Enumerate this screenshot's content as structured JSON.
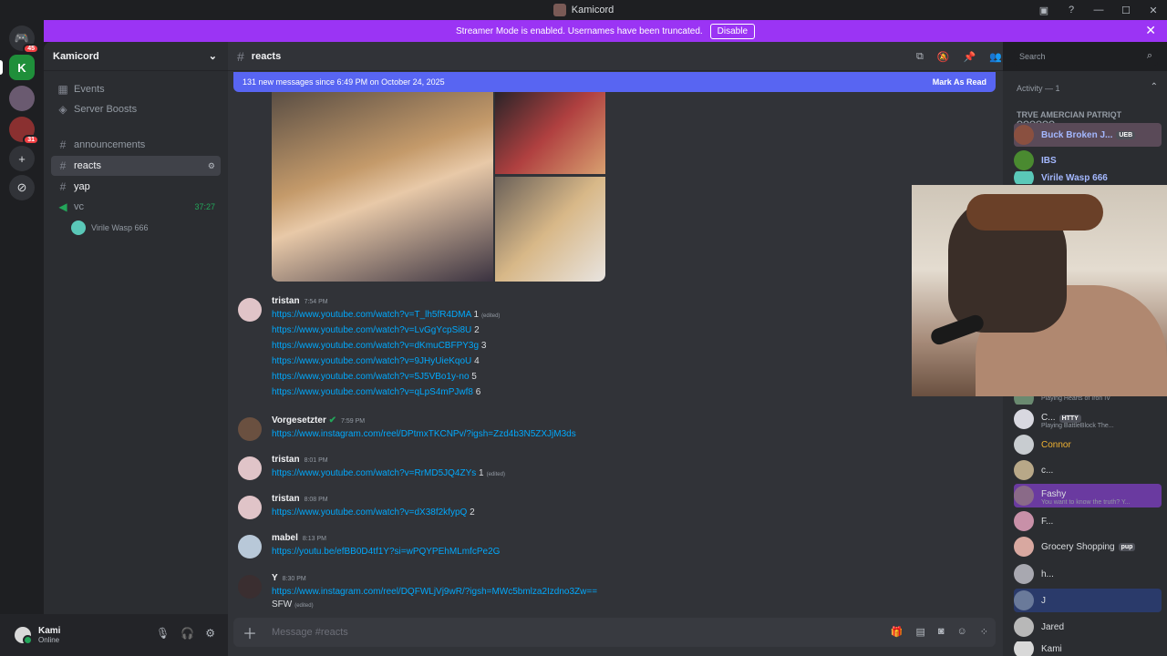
{
  "window": {
    "title": "Kamicord"
  },
  "banner": {
    "text": "Streamer Mode is enabled. Usernames have been truncated.",
    "disable_label": "Disable"
  },
  "servers": [
    {
      "name": "Home",
      "badge": "45"
    },
    {
      "name": "K",
      "badge": ""
    },
    {
      "name": "Kamicord",
      "badge": ""
    },
    {
      "name": "Server",
      "badge": "31"
    }
  ],
  "sidebar": {
    "server_name": "Kamicord",
    "items": [
      {
        "label": "Events"
      },
      {
        "label": "Server Boosts"
      },
      {
        "label": "announcements"
      },
      {
        "label": "reacts"
      },
      {
        "label": "yap"
      },
      {
        "label": "vc",
        "timer": "37:27"
      }
    ],
    "voice_user": "Virile Wasp 666"
  },
  "user": {
    "name": "Kami",
    "status": "Online"
  },
  "chat": {
    "channel": "reacts",
    "new_messages": "131 new messages since 6:49 PM on October 24, 2025",
    "mark_read": "Mark As Read",
    "input_placeholder": "Message #reacts",
    "search_placeholder": "Search",
    "messages": [
      {
        "author": "tristan",
        "time": "7:54 PM",
        "lines": [
          {
            "link": "https://www.youtube.com/watch?v=T_lh5fR4DMA",
            "suffix": "1",
            "edited": "(edited)"
          },
          {
            "link": "https://www.youtube.com/watch?v=LvGgYcpSi8U",
            "suffix": "2",
            "edited": ""
          },
          {
            "link": "https://www.youtube.com/watch?v=dKmuCBFPY3g",
            "suffix": "3",
            "edited": ""
          },
          {
            "link": "https://www.youtube.com/watch?v=9JHyUieKqoU",
            "suffix": "4",
            "edited": ""
          },
          {
            "link": "https://www.youtube.com/watch?v=5J5VBo1y-no",
            "suffix": "5",
            "edited": ""
          },
          {
            "link": "https://www.youtube.com/watch?v=qLpS4mPJwf8",
            "suffix": "6",
            "edited": ""
          }
        ]
      },
      {
        "author": "Vorgesetzter",
        "time": "7:59 PM",
        "lines": [
          {
            "link": "https://www.instagram.com/reel/DPtmxTKCNPv/?igsh=Zzd4b3N5ZXJjM3ds",
            "suffix": "",
            "edited": ""
          }
        ]
      },
      {
        "author": "tristan",
        "time": "8:01 PM",
        "lines": [
          {
            "link": "https://www.youtube.com/watch?v=RrMD5JQ4ZYs",
            "suffix": "1",
            "edited": "(edited)"
          }
        ]
      },
      {
        "author": "tristan",
        "time": "8:08 PM",
        "lines": [
          {
            "link": "https://www.youtube.com/watch?v=dX38f2kfypQ",
            "suffix": "2",
            "edited": ""
          }
        ]
      },
      {
        "author": "mabel",
        "time": "8:13 PM",
        "lines": [
          {
            "link": "https://youtu.be/efBB0D4tf1Y?si=wPQYPEhMLmfcPe2G",
            "suffix": "",
            "edited": ""
          }
        ]
      },
      {
        "author": "Y",
        "time": "8:30 PM",
        "lines": [
          {
            "link": "https://www.instagram.com/reel/DQFWLjVj9wR/?igsh=MWc5bmlza2Izdno3Zw==",
            "suffix": "",
            "edited": ""
          },
          {
            "link": "",
            "suffix": "SFW",
            "edited": "(edited)"
          }
        ]
      }
    ]
  },
  "members": {
    "activity_header": "Activity — 1",
    "group_header": "TRVE AMERCIAN PATRIQT QQQQQQ...",
    "list": [
      {
        "name": "Buck Broken J...",
        "tag": "UEB",
        "status": "",
        "color": "#a4b8ff"
      },
      {
        "name": "IBS",
        "tag": "",
        "status": "",
        "color": "#a4b8ff"
      },
      {
        "name": "Virile Wasp 666",
        "tag": "",
        "status": "",
        "color": "#a4b8ff"
      },
      {
        "name": "",
        "tag": "",
        "status": "Playing Hearts of Iron IV",
        "color": "#dbdee1"
      },
      {
        "name": "C...",
        "tag": "HTTY",
        "status": "Playing BattleBlock The...",
        "color": "#dbdee1"
      },
      {
        "name": "Connor",
        "tag": "",
        "status": "",
        "color": "#f0b232"
      },
      {
        "name": "c...",
        "tag": "",
        "status": "",
        "color": "#dbdee1"
      },
      {
        "name": "Fashy",
        "tag": "",
        "status": "You want to know the truth? Y...",
        "color": "#dbdee1"
      },
      {
        "name": "F...",
        "tag": "",
        "status": "",
        "color": "#dbdee1"
      },
      {
        "name": "Grocery Shopping",
        "tag": "pup",
        "status": "",
        "color": "#dbdee1"
      },
      {
        "name": "h...",
        "tag": "",
        "status": "",
        "color": "#dbdee1"
      },
      {
        "name": "J",
        "tag": "",
        "status": "",
        "color": "#dbdee1"
      },
      {
        "name": "Jared",
        "tag": "",
        "status": "",
        "color": "#dbdee1"
      },
      {
        "name": "Kami",
        "tag": "",
        "status": "",
        "color": "#dbdee1"
      }
    ]
  },
  "colors": {
    "accent": "#5865f2",
    "banner": "#9b34f4",
    "link": "#00a8fc"
  }
}
